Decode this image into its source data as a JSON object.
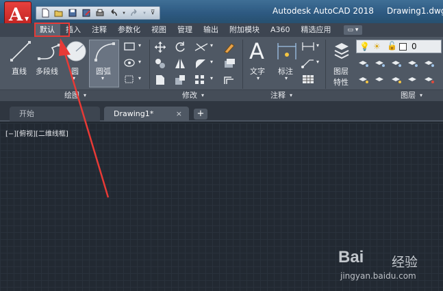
{
  "titlebar": {
    "app_title": "Autodesk AutoCAD 2018",
    "doc_title": "Drawing1.dwg"
  },
  "app_button": {
    "letter": "A"
  },
  "ribbon_tabs": [
    "默认",
    "插入",
    "注释",
    "参数化",
    "视图",
    "管理",
    "输出",
    "附加模块",
    "A360",
    "精选应用"
  ],
  "active_tab": "默认",
  "draw_panel": {
    "line": "直线",
    "polyline": "多段线",
    "circle": "圆",
    "arc": "圆弧",
    "label": "绘图"
  },
  "modify_panel": {
    "label": "修改"
  },
  "annotation_panel": {
    "text": "文字",
    "dimension": "标注",
    "label": "注释"
  },
  "layers_panel": {
    "properties_line1": "图层",
    "properties_line2": "特性",
    "label": "图层",
    "current_layer": "0"
  },
  "doc_tabs": {
    "start": "开始",
    "drawing": "Drawing1*",
    "close": "×",
    "new": "+"
  },
  "viewport_label": "[−][俯视][二维线框]",
  "watermark": {
    "logo": "Bai",
    "brand": "经验",
    "url": "jingyan.baidu.com"
  },
  "colors": {
    "accent_red": "#e83a36",
    "ribbon_bg": "#4f5864",
    "canvas_bg": "#222932"
  }
}
